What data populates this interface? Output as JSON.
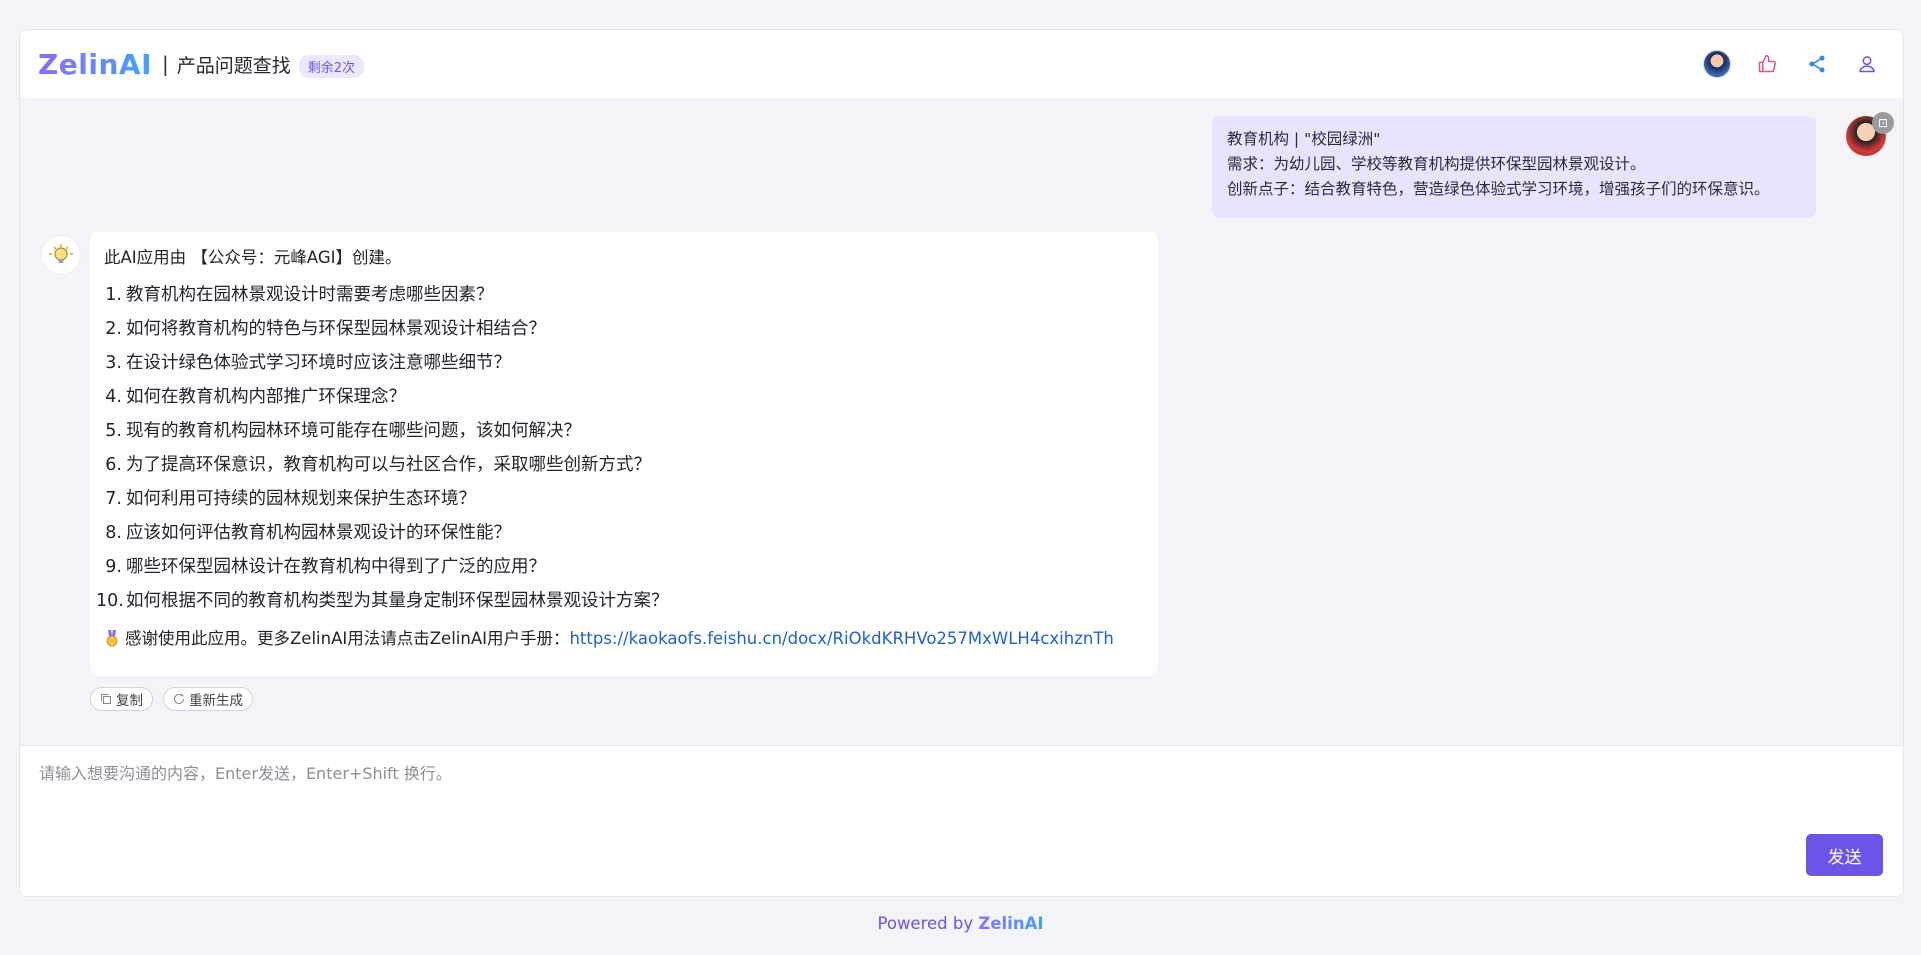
{
  "header": {
    "logo": "ZelinAI",
    "separator": "|",
    "title": "产品问题查找",
    "quota_badge": "剩余2次",
    "actions": [
      {
        "icon": "avatar-icon"
      },
      {
        "icon": "thumbs-up-icon"
      },
      {
        "icon": "share-icon"
      },
      {
        "icon": "user-icon"
      }
    ]
  },
  "user_message": {
    "lines": [
      "教育机构 | \"校园绿洲\"",
      "需求：为幼儿园、学校等教育机构提供环保型园林景观设计。",
      "创新点子：结合教育特色，营造绿色体验式学习环境，增强孩子们的环保意识。"
    ]
  },
  "bot_message": {
    "intro": "此AI应用由 【公众号：元峰AGI】创建。",
    "questions": [
      "教育机构在园林景观设计时需要考虑哪些因素？",
      "如何将教育机构的特色与环保型园林景观设计相结合？",
      "在设计绿色体验式学习环境时应该注意哪些细节？",
      "如何在教育机构内部推广环保理念？",
      "现有的教育机构园林环境可能存在哪些问题，该如何解决？",
      "为了提高环保意识，教育机构可以与社区合作，采取哪些创新方式？",
      "如何利用可持续的园林规划来保护生态环境？",
      "应该如何评估教育机构园林景观设计的环保性能？",
      "哪些环保型园林设计在教育机构中得到了广泛的应用？",
      "如何根据不同的教育机构类型为其量身定制环保型园林景观设计方案？"
    ],
    "thanks_text": "感谢使用此应用。更多ZelinAI用法请点击ZelinAI用户手册：",
    "thanks_link": "https://kaokaofs.feishu.cn/docx/RiOkdKRHVo257MxWLH4cxihznTh"
  },
  "message_actions": {
    "copy_label": "复制",
    "regenerate_label": "重新生成"
  },
  "composer": {
    "placeholder": "请输入想要沟通的内容，Enter发送，Enter+Shift 换行。",
    "value": "",
    "send_label": "发送"
  },
  "footer": {
    "powered_by": "Powered by ",
    "brand": "ZelinAI"
  },
  "colors": {
    "accent": "#6c54e8",
    "user_bubble": "#e8e3ff",
    "link": "#1e5fd6"
  }
}
